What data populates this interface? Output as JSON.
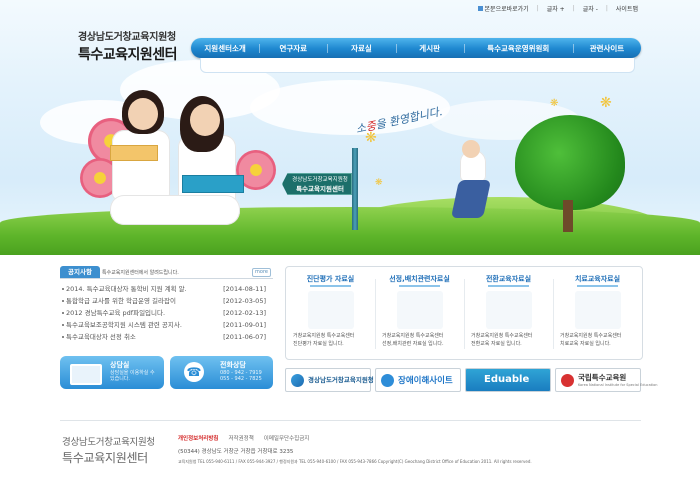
{
  "top_links": {
    "homepage": "본문으로바로가기",
    "font_plus": "글자 +",
    "font_minus": "글자 -",
    "sitemap": "사이트맵"
  },
  "logo": {
    "line1": "경상남도거창교육지원청",
    "line2": "특수교육지원센터"
  },
  "nav": {
    "items": [
      "지원센터소개",
      "연구자료",
      "자료실",
      "게시판",
      "특수교육운영위원회",
      "관련사이트"
    ]
  },
  "hero": {
    "welcome_prefix": "소",
    "welcome_highlight": "중",
    "welcome_rest": "을 환영합니다.",
    "sign_line1": "경상남도거창교육지원청",
    "sign_line2": "특수교육지원센터",
    "colors": {
      "sky": "#e3f2fc",
      "grass": "#5eb52a",
      "nav": "#1e87cf"
    }
  },
  "notice": {
    "tab": "공지사항",
    "tab_text": "특수교육지원센터에서 알려드립니다.",
    "more": "more",
    "items": [
      {
        "title": "2014. 특수교육대상자 통학비 지원 계획 알.",
        "date": "[2014-08-11]"
      },
      {
        "title": "통합학급 교사를 위한 학급운영 길라잡이",
        "date": "[2012-03-05]"
      },
      {
        "title": "2012 경남특수교육 pdf파일입니다.",
        "date": "[2012-02-13]"
      },
      {
        "title": "특수교육보조공학지원 시스템 관련 공지사.",
        "date": "[2011-09-01]"
      },
      {
        "title": "특수교육대상자 선정 취소",
        "date": "[2011-06-07]"
      }
    ]
  },
  "consult": {
    "title": "상담실",
    "sub1": "상담실을 이용하실 수",
    "sub2": "있습니다."
  },
  "call": {
    "title": "전화상담",
    "tel1": "080 - 942 - 7919",
    "tel2": "055 - 942 - 7825"
  },
  "rooms": [
    {
      "title": "진단평가 자료실",
      "desc1": "거창교육지원청 특수교육센터",
      "desc2": "진단평가 자료실 입니다."
    },
    {
      "title": "선정,배치관련자료실",
      "desc1": "거창교육지원청 특수교육센터",
      "desc2": "선정,배치관련 자료실 입니다."
    },
    {
      "title": "전환교육자료실",
      "desc1": "거창교육지원청 특수교육센터",
      "desc2": "전환교육 자료실 입니다."
    },
    {
      "title": "치료교육자료실",
      "desc1": "거창교육지원청 특수교육센터",
      "desc2": "치료교육 자료실 입니다."
    }
  ],
  "banners": {
    "b1": "경상남도거창교육지원청",
    "b2": "장애이해사이트",
    "b3": "Eduable",
    "b4": "국립특수교육원",
    "b4_sub": "Korea National Institute for Special Education"
  },
  "footer": {
    "logo1": "경상남도거창교육지원청",
    "logo2": "특수교육지원센터",
    "privacy": "개인정보처리방침",
    "copyright_policy": "저작권정책",
    "email_policy": "이메일무단수집금지",
    "address": "(50344) 경상남도 거창군 거창읍 거창대로 3235",
    "tel_line": "교육지원청 TEL 055-940-6111 / FAX 055-944-3927 / 행정지원과 TEL 055-940-6100 / FAX 055-943-7866  Copyright(C) Geochang District Office of Education 2011. All rights reserved."
  }
}
